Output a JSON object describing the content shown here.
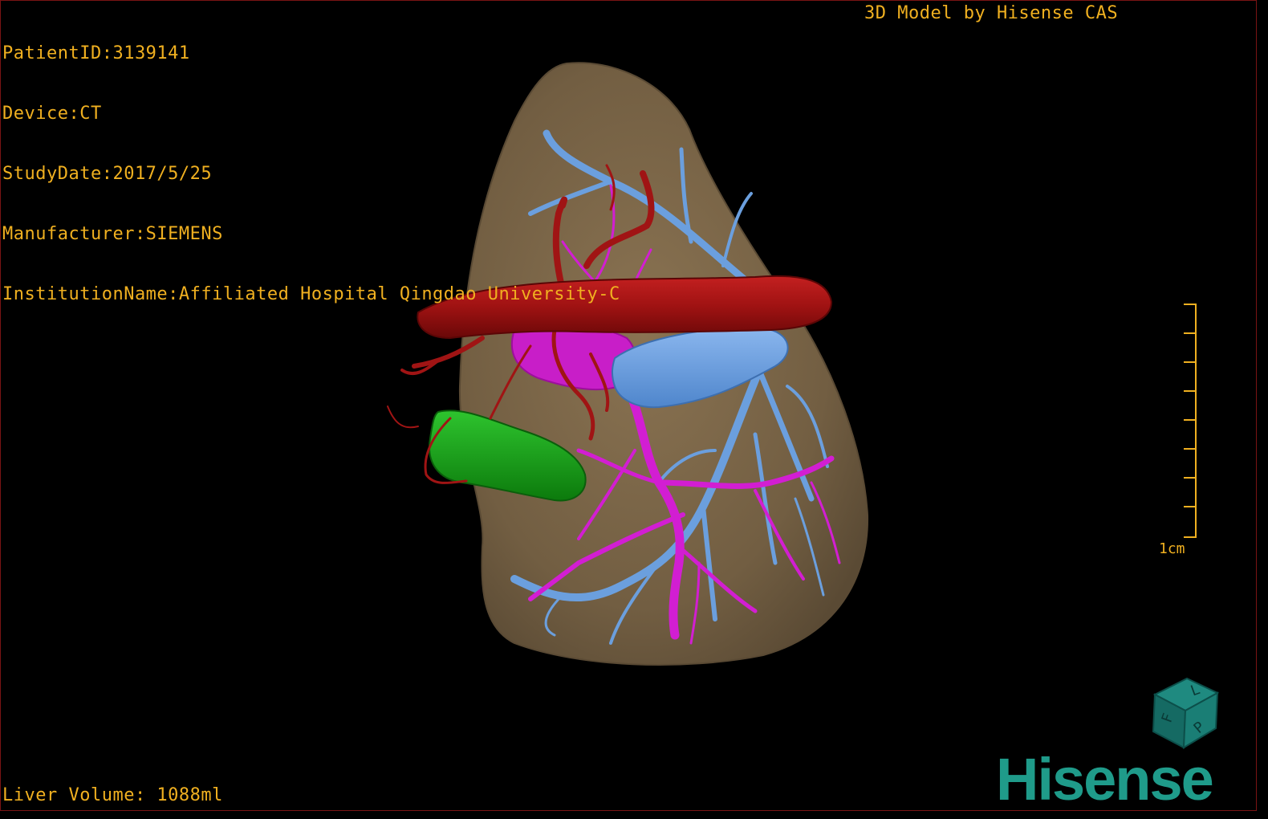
{
  "overlay": {
    "patient_id": "PatientID:3139141",
    "device": "Device:CT",
    "study_date": "StudyDate:2017/5/25",
    "manufacturer": "Manufacturer:SIEMENS",
    "institution": "InstitutionName:Affiliated Hospital Qingdao University-C",
    "branding": "3D Model by Hisense CAS",
    "liver_volume": "Liver Volume: 1088ml"
  },
  "scale_bar": {
    "label": "1cm"
  },
  "orientation_cube": {
    "icon": "orientation-cube-icon",
    "faces": [
      "F",
      "L",
      "P"
    ]
  },
  "logo": {
    "text": "Hisense"
  },
  "colors": {
    "overlay_text": "#f0b020",
    "liver": "#7a6548",
    "artery": "#9e1212",
    "portal_vein": "#d21ed2",
    "hepatic_vein": "#6b9fde",
    "gallbladder": "#17a017",
    "brand": "#1f9b8a"
  }
}
